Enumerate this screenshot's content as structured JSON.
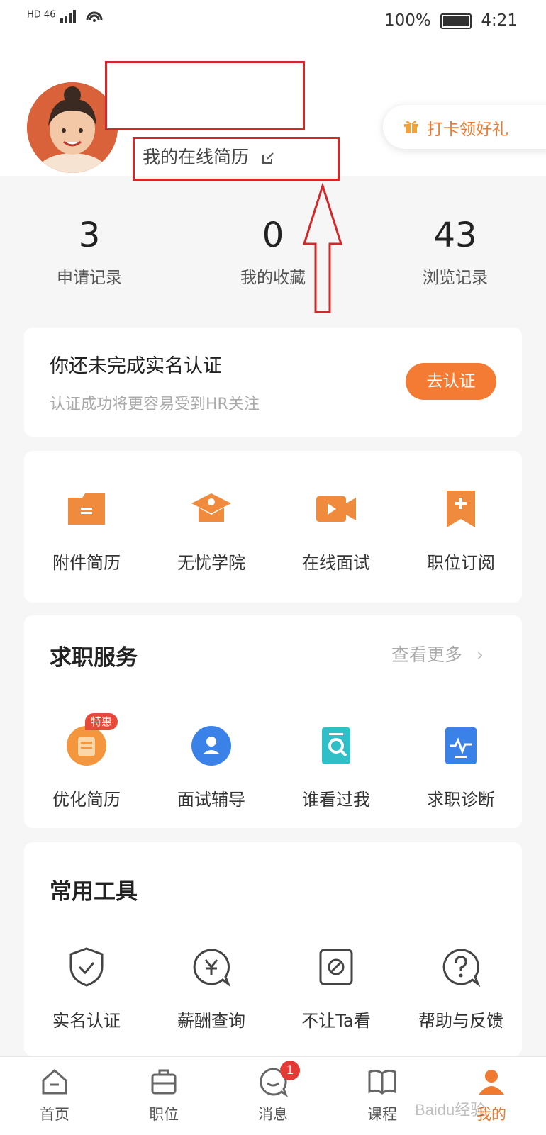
{
  "status_bar": {
    "left_text": "HD 46",
    "battery": "100%",
    "time": "4:21"
  },
  "header": {
    "resume_link": "我的在线简历",
    "checkin": "打卡领好礼"
  },
  "stats": [
    {
      "value": "3",
      "label": "申请记录"
    },
    {
      "value": "0",
      "label": "我的收藏"
    },
    {
      "value": "43",
      "label": "浏览记录"
    }
  ],
  "verify": {
    "title": "你还未完成实名认证",
    "subtitle": "认证成功将更容易受到HR关注",
    "button": "去认证"
  },
  "quick": [
    {
      "label": "附件简历",
      "icon": "folder-icon"
    },
    {
      "label": "无忧学院",
      "icon": "graduation-cap-icon"
    },
    {
      "label": "在线面试",
      "icon": "video-camera-icon"
    },
    {
      "label": "职位订阅",
      "icon": "bookmark-plus-icon"
    }
  ],
  "services": {
    "title": "求职服务",
    "more": "查看更多",
    "badge": "特惠",
    "items": [
      {
        "label": "优化简历",
        "icon": "resume-optimize-icon"
      },
      {
        "label": "面试辅导",
        "icon": "person-icon"
      },
      {
        "label": "谁看过我",
        "icon": "search-doc-icon"
      },
      {
        "label": "求职诊断",
        "icon": "pulse-doc-icon"
      }
    ]
  },
  "tools": {
    "title": "常用工具",
    "items": [
      {
        "label": "实名认证",
        "icon": "shield-check-icon"
      },
      {
        "label": "薪酬查询",
        "icon": "yen-bubble-icon"
      },
      {
        "label": "不让Ta看",
        "icon": "block-doc-icon"
      },
      {
        "label": "帮助与反馈",
        "icon": "help-bubble-icon"
      }
    ]
  },
  "tabbar": {
    "items": [
      {
        "label": "首页",
        "icon": "home-icon"
      },
      {
        "label": "职位",
        "icon": "briefcase-icon"
      },
      {
        "label": "消息",
        "icon": "chat-icon"
      },
      {
        "label": "课程",
        "icon": "book-icon"
      },
      {
        "label": "我的",
        "icon": "profile-icon"
      }
    ],
    "message_badge": "1",
    "active_color": "#f07a2f"
  },
  "watermark": "Baidu经验"
}
